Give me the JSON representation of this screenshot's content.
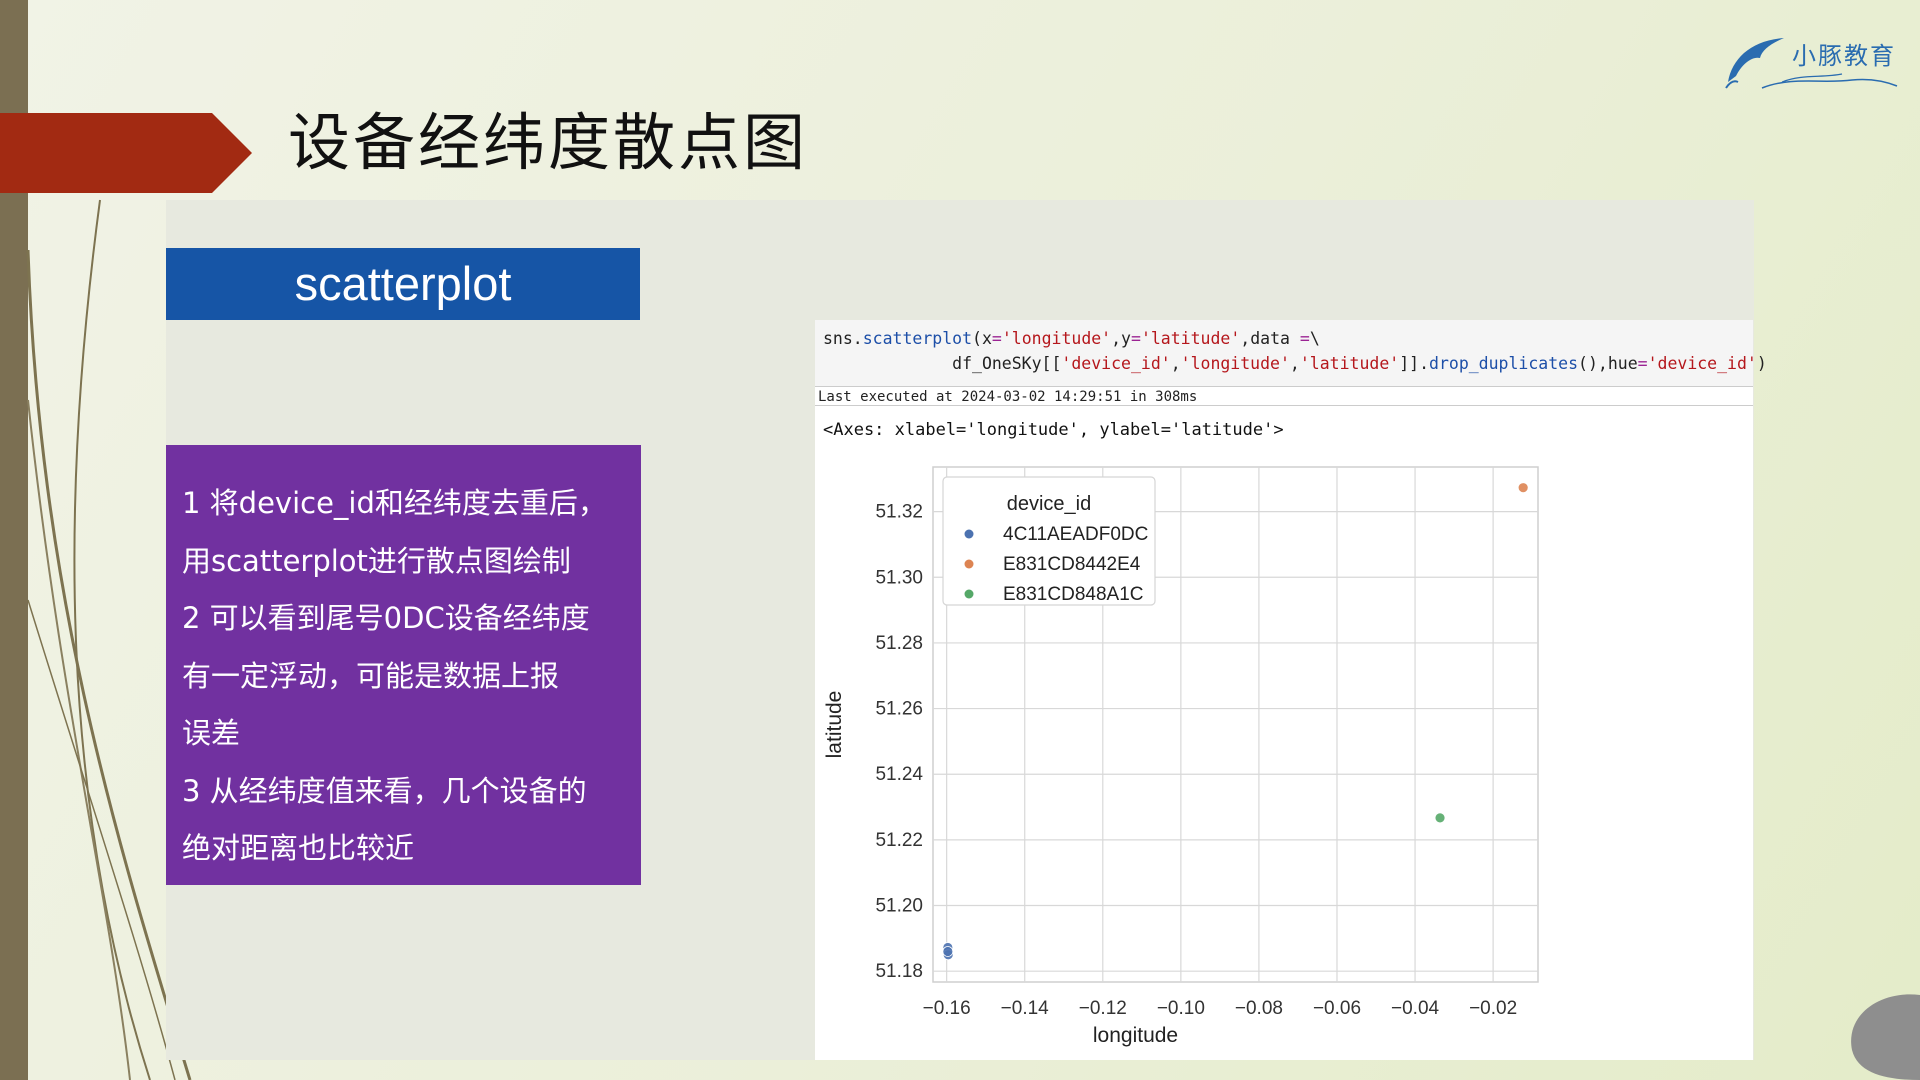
{
  "slide": {
    "title": "设备经纬度散点图",
    "logo_text": "小豚教育",
    "header_label": "scatterplot",
    "notes": [
      "1 将device_id和经纬度去重后，",
      "用scatterplot进行散点图绘制",
      "2 可以看到尾号0DC设备经纬度",
      "有一定浮动，可能是数据上报",
      "误差",
      "3 从经纬度值来看，几个设备的",
      "绝对距离也比较近"
    ]
  },
  "notebook": {
    "exec_info": "Last executed at 2024-03-02 14:29:51 in 308ms",
    "output_text": "<Axes: xlabel='longitude', ylabel='latitude'>"
  },
  "colors": {
    "red_arrow": "#a22a12",
    "blue_header": "#1655a6",
    "purple_box": "#7131a0",
    "series_1": "#4c72b0",
    "series_2": "#dd8452",
    "series_3": "#55a868"
  },
  "chart_data": {
    "type": "scatter",
    "title": "",
    "xlabel": "longitude",
    "ylabel": "latitude",
    "xlim": [
      -0.1635,
      -0.0085
    ],
    "ylim": [
      51.1767,
      51.3336
    ],
    "xticks": [
      -0.16,
      -0.14,
      -0.12,
      -0.1,
      -0.08,
      -0.06,
      -0.04,
      -0.02
    ],
    "xtick_labels": [
      "−0.16",
      "−0.14",
      "−0.12",
      "−0.10",
      "−0.08",
      "−0.06",
      "−0.04",
      "−0.02"
    ],
    "yticks": [
      51.18,
      51.2,
      51.22,
      51.24,
      51.26,
      51.28,
      51.3,
      51.32
    ],
    "ytick_labels": [
      "51.18",
      "51.20",
      "51.22",
      "51.24",
      "51.26",
      "51.28",
      "51.30",
      "51.32"
    ],
    "grid": true,
    "legend": {
      "title": "device_id",
      "placement": "top-left"
    },
    "series": [
      {
        "name": "4C11AEADF0DC",
        "color": "#4c72b0",
        "points": [
          [
            -0.1597,
            51.1872
          ],
          [
            -0.1596,
            51.185
          ],
          [
            -0.1597,
            51.186
          ]
        ]
      },
      {
        "name": "E831CD8442E4",
        "color": "#dd8452",
        "points": [
          [
            -0.0123,
            51.3273
          ]
        ]
      },
      {
        "name": "E831CD848A1C",
        "color": "#55a868",
        "points": [
          [
            -0.0336,
            51.2267
          ]
        ]
      }
    ]
  }
}
